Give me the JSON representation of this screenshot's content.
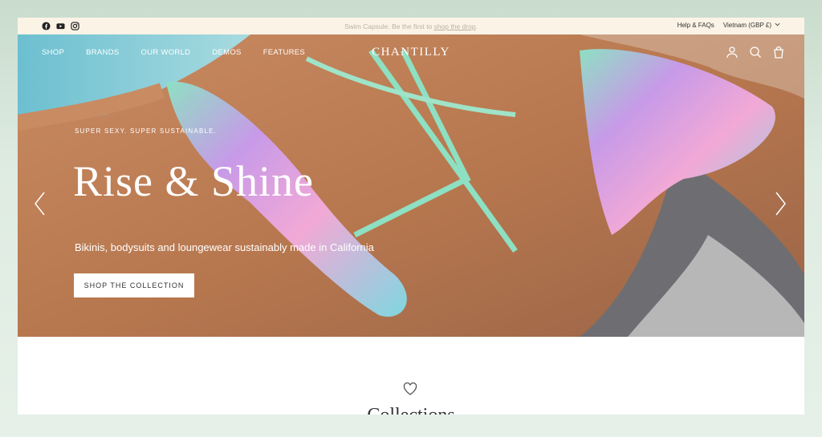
{
  "announcement": {
    "text": "Swim Capsule. Be the first to ",
    "link": "shop the drop",
    "suffix": "."
  },
  "utility": {
    "help": "Help & FAQs",
    "locale": "Vietnam (GBP £)"
  },
  "social": [
    "facebook-icon",
    "youtube-icon",
    "instagram-icon"
  ],
  "nav": {
    "items": [
      "SHOP",
      "BRANDS",
      "OUR WORLD",
      "DEMOS",
      "FEATURES"
    ],
    "logo": "CHANTILLY",
    "icons": [
      "account-icon",
      "search-icon",
      "cart-icon"
    ]
  },
  "hero": {
    "eyebrow": "SUPER SEXY. SUPER SUSTAINABLE.",
    "headline": "Rise & Shine",
    "subline": "Bikinis, bodysuits and loungewear sustainably made in California",
    "cta": "SHOP THE COLLECTION"
  },
  "collections": {
    "title": "Collections"
  },
  "colors": {
    "announce_bg": "#fbf3e6",
    "page_bg": "#dfece2"
  }
}
